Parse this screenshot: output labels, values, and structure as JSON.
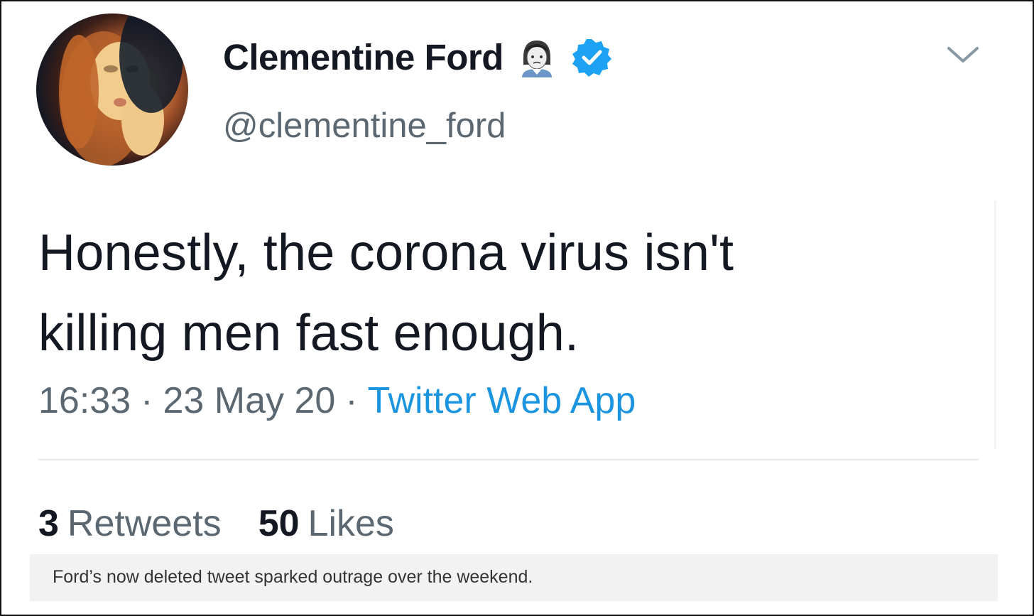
{
  "tweet": {
    "author": {
      "display_name": "Clementine Ford",
      "handle": "@clementine_ford",
      "verified": true,
      "name_emoji": "woman-with-white-cap-emoji",
      "avatar": "profile-photo"
    },
    "text_lines": [
      "Honestly, the corona virus isn't",
      "killing men fast enough."
    ],
    "time": "16:33",
    "separator": "·",
    "date": "23 May 20",
    "source": "Twitter Web App",
    "retweets": {
      "count": "3",
      "label": "Retweets"
    },
    "likes": {
      "count": "50",
      "label": "Likes"
    },
    "menu_icon": "chevron-down-icon"
  },
  "caption": "Ford’s now deleted tweet sparked outrage over the weekend.",
  "colors": {
    "text_primary": "#141823",
    "text_secondary": "#5b6872",
    "link": "#1b95e0",
    "verified_badge": "#1da1f2",
    "caption_bg": "#f2f2f2",
    "border": "#111111"
  }
}
